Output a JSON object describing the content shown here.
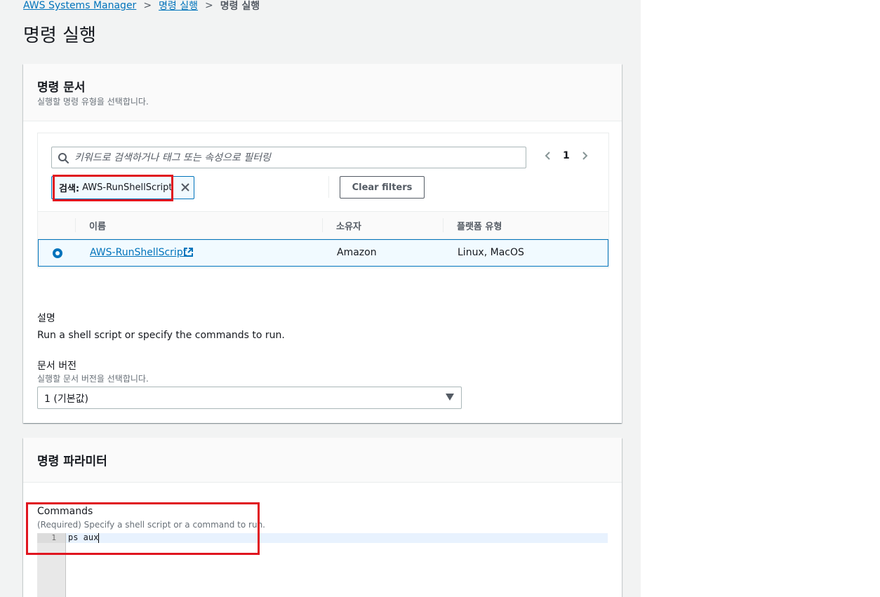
{
  "breadcrumb": {
    "root": "AWS Systems Manager",
    "parent": "명령 실행",
    "current": "명령 실행"
  },
  "page_title": "명령 실행",
  "document_panel": {
    "title": "명령 문서",
    "description": "실행할 명령 유형을 선택합니다.",
    "search": {
      "placeholder": "키워드로 검색하거나 태그 또는 속성으로 필터링",
      "value": ""
    },
    "pagination": {
      "current_page": "1"
    },
    "filter_token": {
      "label": "검색:",
      "value": "AWS-RunShellScript"
    },
    "clear_filters_label": "Clear filters",
    "table": {
      "columns": [
        "이름",
        "소유자",
        "플랫폼 유형"
      ],
      "rows": [
        {
          "name": "AWS-RunShellScript",
          "owner": "Amazon",
          "platform": "Linux, MacOS",
          "selected": true
        }
      ]
    },
    "description_section": {
      "label": "설명",
      "text": "Run a shell script or specify the commands to run."
    },
    "version": {
      "label": "문서 버전",
      "description": "실행할 문서 버전을 선택합니다.",
      "selected": "1 (기본값)"
    }
  },
  "parameters_panel": {
    "title": "명령 파라미터",
    "commands": {
      "label": "Commands",
      "description": "(Required) Specify a shell script or a command to run.",
      "line_numbers": [
        "1"
      ],
      "lines": [
        "ps aux"
      ]
    }
  },
  "colors": {
    "link": "#0073bb",
    "highlight_box": "#e0151f",
    "selected_row_bg": "#f1faff",
    "page_bg": "#f2f3f3"
  },
  "icons": {
    "search": "search-icon",
    "prev": "chevron-left-icon",
    "next": "chevron-right-icon",
    "token_remove": "close-icon",
    "external_link": "external-link-icon",
    "select_caret": "caret-down-icon"
  }
}
